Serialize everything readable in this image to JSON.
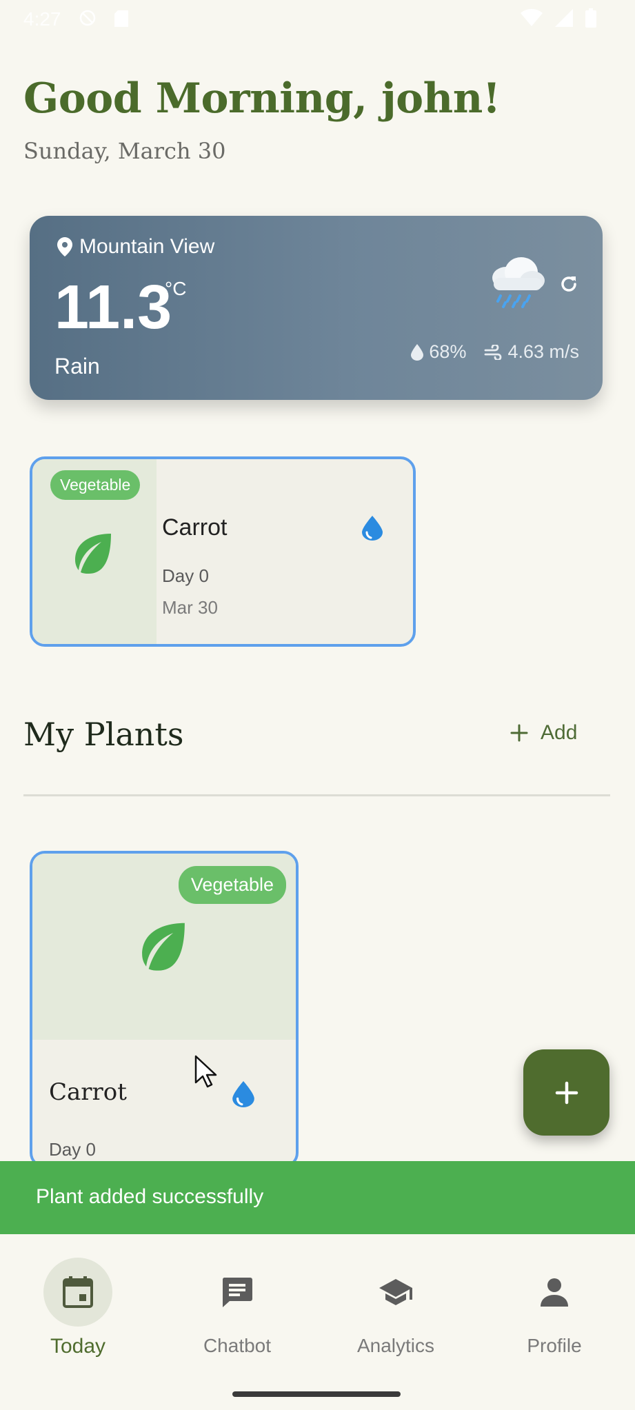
{
  "status_bar": {
    "time": "4:27"
  },
  "header": {
    "greeting": "Good Morning, john!",
    "date": "Sunday, March 30"
  },
  "weather": {
    "location": "Mountain View",
    "temperature": "11.3",
    "unit": "°C",
    "condition": "Rain",
    "humidity": "68%",
    "wind": "4.63 m/s",
    "icons": {
      "location": "location-pin-icon",
      "condition": "rain-cloud-icon",
      "refresh": "refresh-icon",
      "humidity": "droplet-icon",
      "wind": "wind-icon"
    }
  },
  "today_plant": {
    "category": "Vegetable",
    "name": "Carrot",
    "day": "Day 0",
    "date": "Mar 30",
    "icons": {
      "plant": "leaf-icon",
      "water": "water-drop-icon"
    }
  },
  "my_plants": {
    "title": "My Plants",
    "add_label": "Add",
    "items": [
      {
        "category": "Vegetable",
        "name": "Carrot",
        "day": "Day 0"
      }
    ]
  },
  "snackbar": {
    "message": "Plant added successfully"
  },
  "bottom_nav": {
    "items": [
      {
        "label": "Today",
        "icon": "calendar-icon",
        "active": true
      },
      {
        "label": "Chatbot",
        "icon": "chat-icon",
        "active": false
      },
      {
        "label": "Analytics",
        "icon": "school-icon",
        "active": false
      },
      {
        "label": "Profile",
        "icon": "person-icon",
        "active": false
      }
    ]
  },
  "colors": {
    "background": "#f8f7f0",
    "accent_green": "#4f6c2e",
    "badge_green": "#6abf69",
    "card_border": "#5ea0ec",
    "snackbar": "#4caf50",
    "water_blue": "#2b8be0"
  }
}
